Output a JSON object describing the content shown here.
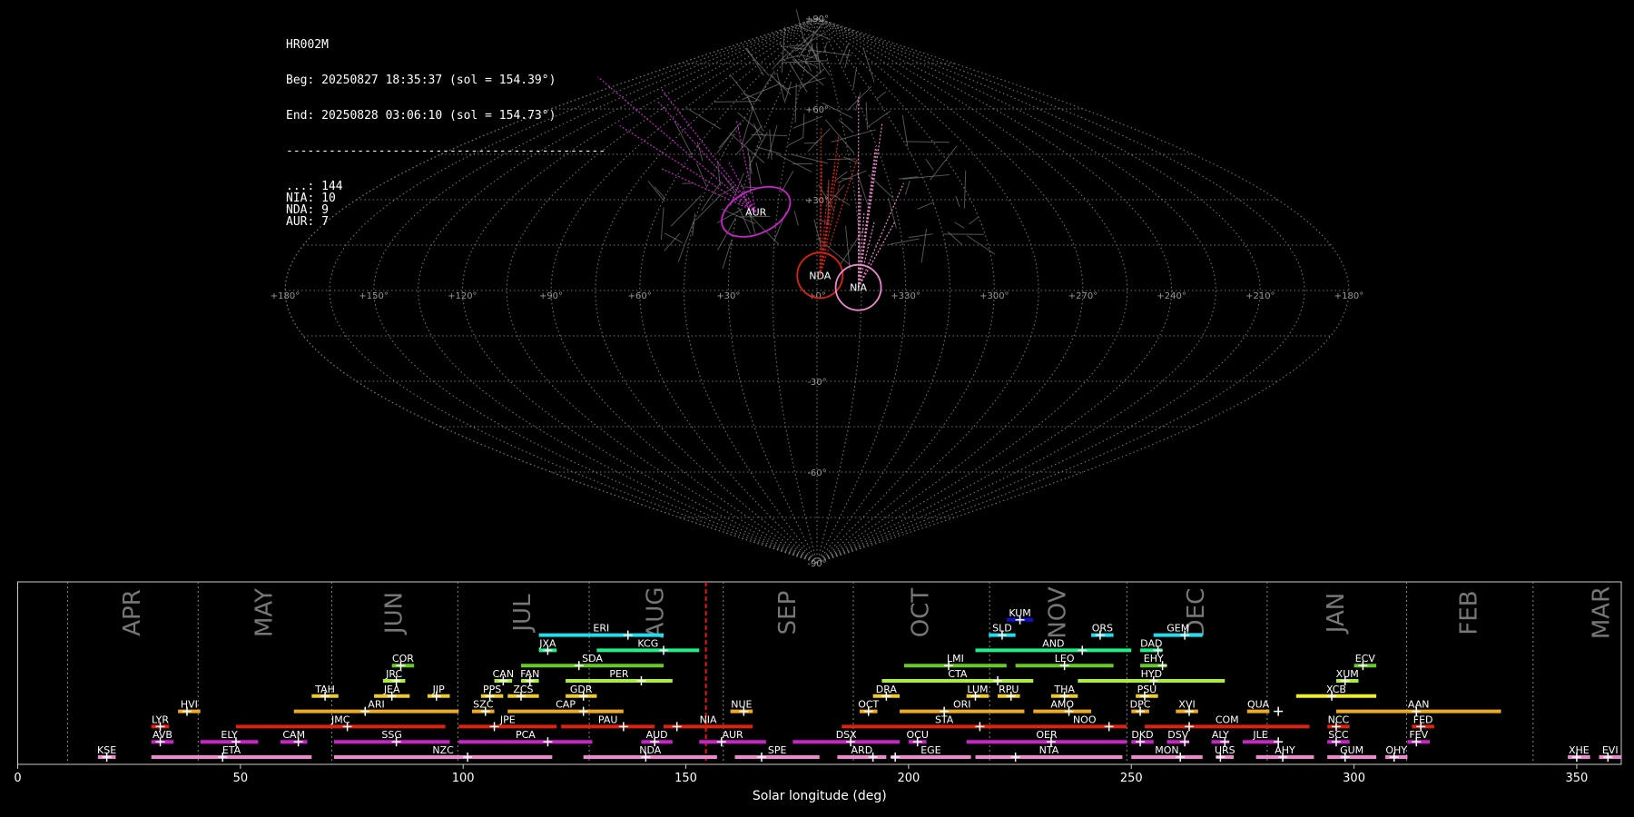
{
  "chart_data": [
    {
      "type": "scatter",
      "projection": "sinusoidal",
      "info": {
        "station": "HR002M",
        "begin": "Beg: 20250827 18:35:37 (sol = 154.39°)",
        "end": "End: 20250828 03:06:10 (sol = 154.73°)",
        "separator": "---------------------------------------------",
        "counts": [
          {
            "label": "...",
            "value": 144
          },
          {
            "label": "NIA",
            "value": 10
          },
          {
            "label": "NDA",
            "value": 9
          },
          {
            "label": "AUR",
            "value": 7
          }
        ]
      },
      "longitude_ticks": [
        "+180°",
        "+150°",
        "+120°",
        "+90°",
        "+60°",
        "+30°",
        "+0°",
        "+330°",
        "+300°",
        "+270°",
        "+240°",
        "+210°",
        "+180°"
      ],
      "latitude_ticks": [
        "+90°",
        "+60°",
        "+30°",
        "-30°",
        "-60°",
        "-90°"
      ],
      "radiants": [
        {
          "code": "AUR",
          "lon": 23,
          "lat": 26,
          "color": "#cc22cc"
        },
        {
          "code": "NDA",
          "lon": 359,
          "lat": 5,
          "color": "#dd2211"
        },
        {
          "code": "NIA",
          "lon": 346,
          "lat": 1,
          "color": "#ee88cc"
        }
      ]
    },
    {
      "type": "timeline",
      "xlabel": "Solar longitude (deg)",
      "xlim": [
        0,
        360
      ],
      "xticks": [
        0,
        50,
        100,
        150,
        200,
        250,
        300,
        350
      ],
      "current_sol": 154.5,
      "months": [
        {
          "name": "APR",
          "start": 11.2,
          "end": 40.5
        },
        {
          "name": "MAY",
          "start": 40.5,
          "end": 70.5
        },
        {
          "name": "JUN",
          "start": 70.5,
          "end": 98.8
        },
        {
          "name": "JUL",
          "start": 98.8,
          "end": 128.3
        },
        {
          "name": "AUG",
          "start": 128.3,
          "end": 158.4
        },
        {
          "name": "SEP",
          "start": 158.4,
          "end": 187.6
        },
        {
          "name": "OCT",
          "start": 187.6,
          "end": 218.2
        },
        {
          "name": "NOV",
          "start": 218.2,
          "end": 249.0
        },
        {
          "name": "DEC",
          "start": 249.0,
          "end": 280.5
        },
        {
          "name": "JAN",
          "start": 280.5,
          "end": 311.8
        },
        {
          "name": "FEB",
          "start": 311.8,
          "end": 340.2
        },
        {
          "name": "MAR",
          "start": 340.2,
          "end": 371.2
        }
      ],
      "showers": [
        {
          "code": "KUM",
          "start": 222,
          "end": 228,
          "peak": 225,
          "row": 9,
          "color": "#1111cc"
        },
        {
          "code": "ERI",
          "start": 117,
          "end": 145,
          "peak": 137,
          "row": 8,
          "color": "#22ddee"
        },
        {
          "code": "SLD",
          "start": 218,
          "end": 224,
          "peak": 221,
          "row": 8,
          "color": "#22ddee"
        },
        {
          "code": "ORS",
          "start": 241,
          "end": 246,
          "peak": 243,
          "row": 8,
          "color": "#22ddee"
        },
        {
          "code": "GEM",
          "start": 255,
          "end": 266,
          "peak": 262,
          "row": 8,
          "color": "#22ddee"
        },
        {
          "code": "JXA",
          "start": 117,
          "end": 121,
          "peak": 119,
          "row": 7,
          "color": "#22ee88"
        },
        {
          "code": "KCG",
          "start": 130,
          "end": 153,
          "peak": 145,
          "row": 7,
          "color": "#22ee88"
        },
        {
          "code": "AND",
          "start": 215,
          "end": 250,
          "peak": 239,
          "row": 7,
          "color": "#22ee88"
        },
        {
          "code": "DAD",
          "start": 252,
          "end": 257,
          "peak": 256,
          "row": 7,
          "color": "#22ee88"
        },
        {
          "code": "COR",
          "start": 84,
          "end": 89,
          "peak": 86,
          "row": 6,
          "color": "#66cc22"
        },
        {
          "code": "SDA",
          "start": 113,
          "end": 145,
          "peak": 126,
          "row": 6,
          "color": "#66cc22"
        },
        {
          "code": "LMI",
          "start": 199,
          "end": 222,
          "peak": 209,
          "row": 6,
          "color": "#66cc22"
        },
        {
          "code": "LEO",
          "start": 224,
          "end": 246,
          "peak": 235,
          "row": 6,
          "color": "#66cc22"
        },
        {
          "code": "EHY",
          "start": 252,
          "end": 258,
          "peak": 257,
          "row": 6,
          "color": "#66cc22"
        },
        {
          "code": "ECV",
          "start": 300,
          "end": 305,
          "peak": 302,
          "row": 6,
          "color": "#66cc22"
        },
        {
          "code": "JRC",
          "start": 82,
          "end": 87,
          "peak": 85,
          "row": 5,
          "color": "#aaee44"
        },
        {
          "code": "CAN",
          "start": 107,
          "end": 111,
          "peak": 109,
          "row": 5,
          "color": "#aaee44"
        },
        {
          "code": "FAN",
          "start": 113,
          "end": 117,
          "peak": 115,
          "row": 5,
          "color": "#aaee44"
        },
        {
          "code": "PER",
          "start": 123,
          "end": 147,
          "peak": 140,
          "row": 5,
          "color": "#aaee44"
        },
        {
          "code": "CTA",
          "start": 194,
          "end": 228,
          "peak": 220,
          "row": 5,
          "color": "#aaee44"
        },
        {
          "code": "HYD",
          "start": 238,
          "end": 271,
          "peak": 255,
          "row": 5,
          "color": "#aaee44"
        },
        {
          "code": "XUM",
          "start": 296,
          "end": 301,
          "peak": 298,
          "row": 5,
          "color": "#aaee44"
        },
        {
          "code": "TAH",
          "start": 66,
          "end": 72,
          "peak": 69,
          "row": 4,
          "color": "#eecc22"
        },
        {
          "code": "JEA",
          "start": 80,
          "end": 88,
          "peak": 84,
          "row": 4,
          "color": "#eecc22"
        },
        {
          "code": "JIP",
          "start": 92,
          "end": 97,
          "peak": 94,
          "row": 4,
          "color": "#eecc22"
        },
        {
          "code": "PPS",
          "start": 104,
          "end": 109,
          "peak": 106,
          "row": 4,
          "color": "#eecc22"
        },
        {
          "code": "ZCS",
          "start": 110,
          "end": 117,
          "peak": 113,
          "row": 4,
          "color": "#eecc22"
        },
        {
          "code": "GDR",
          "start": 123,
          "end": 130,
          "peak": 127,
          "row": 4,
          "color": "#eecc22"
        },
        {
          "code": "DRA",
          "start": 192,
          "end": 198,
          "peak": 195,
          "row": 4,
          "color": "#eecc22"
        },
        {
          "code": "LUM",
          "start": 213,
          "end": 218,
          "peak": 215,
          "row": 4,
          "color": "#eecc22"
        },
        {
          "code": "RPU",
          "start": 220,
          "end": 225,
          "peak": 223,
          "row": 4,
          "color": "#eecc22"
        },
        {
          "code": "THA",
          "start": 232,
          "end": 238,
          "peak": 235,
          "row": 4,
          "color": "#eecc22"
        },
        {
          "code": "PSU",
          "start": 251,
          "end": 256,
          "peak": 253,
          "row": 4,
          "color": "#eecc22"
        },
        {
          "code": "XCB",
          "start": 287,
          "end": 305,
          "peak": 295,
          "row": 4,
          "color": "#eeee22"
        },
        {
          "code": "HVI",
          "start": 36,
          "end": 41,
          "peak": 38,
          "row": 3,
          "color": "#eeaa22"
        },
        {
          "code": "ARI",
          "start": 62,
          "end": 99,
          "peak": 78,
          "row": 3,
          "color": "#eeaa22"
        },
        {
          "code": "SZC",
          "start": 102,
          "end": 107,
          "peak": 105,
          "row": 3,
          "color": "#eeaa22"
        },
        {
          "code": "CAP",
          "start": 110,
          "end": 136,
          "peak": 127,
          "row": 3,
          "color": "#eeaa22"
        },
        {
          "code": "NUE",
          "start": 160,
          "end": 165,
          "peak": 163,
          "row": 3,
          "color": "#eeaa22"
        },
        {
          "code": "OCT",
          "start": 189,
          "end": 193,
          "peak": 191,
          "row": 3,
          "color": "#eeaa22"
        },
        {
          "code": "ORI",
          "start": 198,
          "end": 226,
          "peak": 208,
          "row": 3,
          "color": "#eeaa22"
        },
        {
          "code": "AMO",
          "start": 228,
          "end": 241,
          "peak": 236,
          "row": 3,
          "color": "#eeaa22"
        },
        {
          "code": "DPC",
          "start": 250,
          "end": 254,
          "peak": 252,
          "row": 3,
          "color": "#eeaa22"
        },
        {
          "code": "XVI",
          "start": 260,
          "end": 265,
          "peak": 263,
          "row": 3,
          "color": "#eeaa22"
        },
        {
          "code": "QUA",
          "start": 276,
          "end": 281,
          "peak": 283,
          "row": 3,
          "color": "#eeaa22"
        },
        {
          "code": "AAN",
          "start": 296,
          "end": 333,
          "peak": 314,
          "row": 3,
          "color": "#eeaa22"
        },
        {
          "code": "LYR",
          "start": 30,
          "end": 34,
          "peak": 32,
          "row": 2,
          "color": "#dd2211"
        },
        {
          "code": "JMC",
          "start": 49,
          "end": 96,
          "peak": 74,
          "row": 2,
          "color": "#dd2211"
        },
        {
          "code": "JPE",
          "start": 99,
          "end": 121,
          "peak": 107,
          "row": 2,
          "color": "#dd2211"
        },
        {
          "code": "PAU",
          "start": 122,
          "end": 143,
          "peak": 136,
          "row": 2,
          "color": "#dd2211"
        },
        {
          "code": "NIA",
          "start": 145,
          "end": 165,
          "peak": 148,
          "row": 2,
          "color": "#dd2211"
        },
        {
          "code": "STA",
          "start": 185,
          "end": 231,
          "peak": 216,
          "row": 2,
          "color": "#dd2211"
        },
        {
          "code": "NOO",
          "start": 230,
          "end": 249,
          "peak": 245,
          "row": 2,
          "color": "#dd2211"
        },
        {
          "code": "COM",
          "start": 253,
          "end": 290,
          "peak": 263,
          "row": 2,
          "color": "#dd2211"
        },
        {
          "code": "NCC",
          "start": 294,
          "end": 299,
          "peak": 296,
          "row": 2,
          "color": "#dd2211"
        },
        {
          "code": "FED",
          "start": 313,
          "end": 318,
          "peak": 315,
          "row": 2,
          "color": "#dd2211"
        },
        {
          "code": "AVB",
          "start": 30,
          "end": 35,
          "peak": 32,
          "row": 1,
          "color": "#cc22cc"
        },
        {
          "code": "ELY",
          "start": 41,
          "end": 54,
          "peak": 49,
          "row": 1,
          "color": "#cc22cc"
        },
        {
          "code": "CAM",
          "start": 59,
          "end": 65,
          "peak": 63,
          "row": 1,
          "color": "#cc22cc"
        },
        {
          "code": "SSG",
          "start": 71,
          "end": 97,
          "peak": 85,
          "row": 1,
          "color": "#cc22cc"
        },
        {
          "code": "PCA",
          "start": 99,
          "end": 129,
          "peak": 119,
          "row": 1,
          "color": "#cc22cc"
        },
        {
          "code": "AUD",
          "start": 140,
          "end": 147,
          "peak": 143,
          "row": 1,
          "color": "#cc22cc"
        },
        {
          "code": "AUR",
          "start": 153,
          "end": 168,
          "peak": 158,
          "row": 1,
          "color": "#cc22cc"
        },
        {
          "code": "DSX",
          "start": 174,
          "end": 198,
          "peak": 187,
          "row": 1,
          "color": "#cc22cc"
        },
        {
          "code": "OCU",
          "start": 200,
          "end": 204,
          "peak": 202,
          "row": 1,
          "color": "#cc22cc"
        },
        {
          "code": "OER",
          "start": 213,
          "end": 249,
          "peak": 232,
          "row": 1,
          "color": "#cc22cc"
        },
        {
          "code": "DKD",
          "start": 250,
          "end": 255,
          "peak": 252,
          "row": 1,
          "color": "#cc22cc"
        },
        {
          "code": "DSV",
          "start": 258,
          "end": 263,
          "peak": 262,
          "row": 1,
          "color": "#cc22cc"
        },
        {
          "code": "ALY",
          "start": 268,
          "end": 272,
          "peak": 271,
          "row": 1,
          "color": "#cc22cc"
        },
        {
          "code": "JLE",
          "start": 275,
          "end": 283,
          "peak": 283,
          "row": 1,
          "color": "#cc22cc"
        },
        {
          "code": "SCC",
          "start": 294,
          "end": 299,
          "peak": 296,
          "row": 1,
          "color": "#cc22cc"
        },
        {
          "code": "FEV",
          "start": 312,
          "end": 317,
          "peak": 314,
          "row": 1,
          "color": "#cc22cc"
        },
        {
          "code": "KSE",
          "start": 18,
          "end": 22,
          "peak": 20,
          "row": 0,
          "color": "#ee88cc"
        },
        {
          "code": "ETA",
          "start": 30,
          "end": 66,
          "peak": 46,
          "row": 0,
          "color": "#ee88cc"
        },
        {
          "code": "NZC",
          "start": 71,
          "end": 120,
          "peak": 101,
          "row": 0,
          "color": "#ee88cc"
        },
        {
          "code": "NDA",
          "start": 127,
          "end": 157,
          "peak": 141,
          "row": 0,
          "color": "#ee88cc"
        },
        {
          "code": "SPE",
          "start": 161,
          "end": 180,
          "peak": 167,
          "row": 0,
          "color": "#ee88cc"
        },
        {
          "code": "ARD",
          "start": 184,
          "end": 195,
          "peak": 192,
          "row": 0,
          "color": "#ee88cc"
        },
        {
          "code": "EGE",
          "start": 196,
          "end": 214,
          "peak": 197,
          "row": 0,
          "color": "#ee88cc"
        },
        {
          "code": "NTA",
          "start": 215,
          "end": 248,
          "peak": 224,
          "row": 0,
          "color": "#ee88cc"
        },
        {
          "code": "MON",
          "start": 250,
          "end": 266,
          "peak": 261,
          "row": 0,
          "color": "#ee88cc"
        },
        {
          "code": "URS",
          "start": 269,
          "end": 273,
          "peak": 270,
          "row": 0,
          "color": "#ee88cc"
        },
        {
          "code": "AHY",
          "start": 278,
          "end": 291,
          "peak": 284,
          "row": 0,
          "color": "#ee88cc"
        },
        {
          "code": "GUM",
          "start": 294,
          "end": 305,
          "peak": 298,
          "row": 0,
          "color": "#ee88cc"
        },
        {
          "code": "OHY",
          "start": 307,
          "end": 312,
          "peak": 309,
          "row": 0,
          "color": "#ee88cc"
        },
        {
          "code": "XHE",
          "start": 348,
          "end": 353,
          "peak": 350,
          "row": 0,
          "color": "#ee88cc"
        },
        {
          "code": "EVI",
          "start": 355,
          "end": 360,
          "peak": 357,
          "row": 0,
          "color": "#ee88cc"
        }
      ]
    }
  ]
}
